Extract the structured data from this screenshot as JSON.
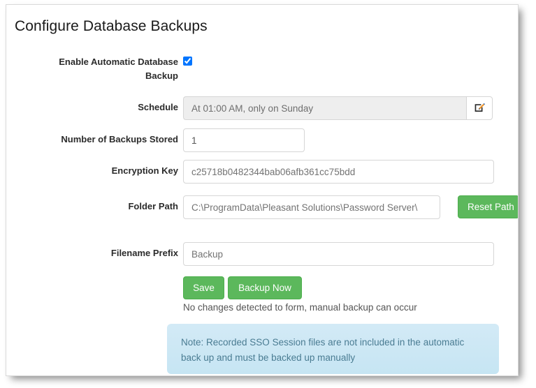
{
  "page": {
    "title": "Configure Database Backups"
  },
  "form": {
    "enable_backup": {
      "label": "Enable Automatic Database Backup",
      "checked": true
    },
    "schedule": {
      "label": "Schedule",
      "value": "At 01:00 AM, only on Sunday",
      "edit_icon": "edit-square-icon"
    },
    "backups_stored": {
      "label": "Number of Backups Stored",
      "value": "1",
      "increment_icon": "caret-up-icon",
      "decrement_icon": "caret-down-icon"
    },
    "encryption_key": {
      "label": "Encryption Key",
      "value": "c25718b0482344bab06afb361cc75bdd"
    },
    "folder_path": {
      "label": "Folder Path",
      "value": "C:\\ProgramData\\Pleasant Solutions\\Password Server\\",
      "reset_label": "Reset Path"
    },
    "filename_prefix": {
      "label": "Filename Prefix",
      "value": "Backup"
    }
  },
  "actions": {
    "save_label": "Save",
    "backup_now_label": "Backup Now",
    "status_message": "No changes detected to form, manual backup can occur"
  },
  "note": {
    "text": "Note: Recorded SSO Session files are not included in the automatic back up and must be backed up manually"
  },
  "colors": {
    "button_green": "#5cb85c",
    "note_background": "#cbe7f4",
    "note_text": "#4a7c92",
    "readonly_background": "#eeeeee"
  }
}
